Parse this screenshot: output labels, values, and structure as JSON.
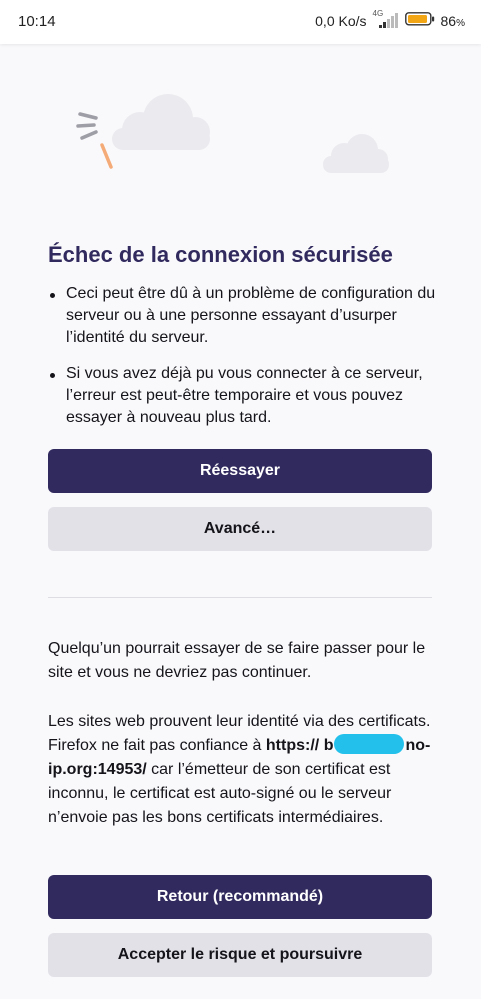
{
  "status_bar": {
    "time": "10:14",
    "net_speed": "0,0 Ko/s",
    "network": "4G",
    "battery_pct": "86",
    "battery_unit": "%"
  },
  "icons": {
    "signal": "signal-icon",
    "battery": "battery-icon",
    "illustration": "broken-lock-clouds-illustration"
  },
  "error": {
    "title": "Échec de la connexion sécurisée",
    "bullets": [
      "Ceci peut être dû à un problème de configuration du serveur ou à une personne essayant d’usurper l’identité du serveur.",
      "Si vous avez déjà pu vous connecter à ce serveur, l’erreur est peut-être temporaire et vous pouvez essayer à nouveau plus tard."
    ]
  },
  "buttons": {
    "retry": "Réessayer",
    "advanced": "Avancé…",
    "back": "Retour (recommandé)",
    "accept": "Accepter le risque et poursuivre"
  },
  "advanced": {
    "warning": "Quelqu’un pourrait essayer de se faire passer pour le site et vous ne devriez pas continuer.",
    "cert_intro": "Les sites web prouvent leur identité via des certificats. Firefox ne fait pas confiance à ",
    "url_prefix": "https://",
    "url_start": "b",
    "url_suffix": "no-ip.org:14953/",
    "cert_reason": " car l’émetteur de son certificat est inconnu, le certificat est auto-signé ou le serveur n’envoie pas les bons certificats intermédiaires."
  },
  "colors": {
    "primary": "#312a5e",
    "secondary": "#e2e1e8",
    "background": "#f9f9fb",
    "redaction": "#22c0ea"
  }
}
